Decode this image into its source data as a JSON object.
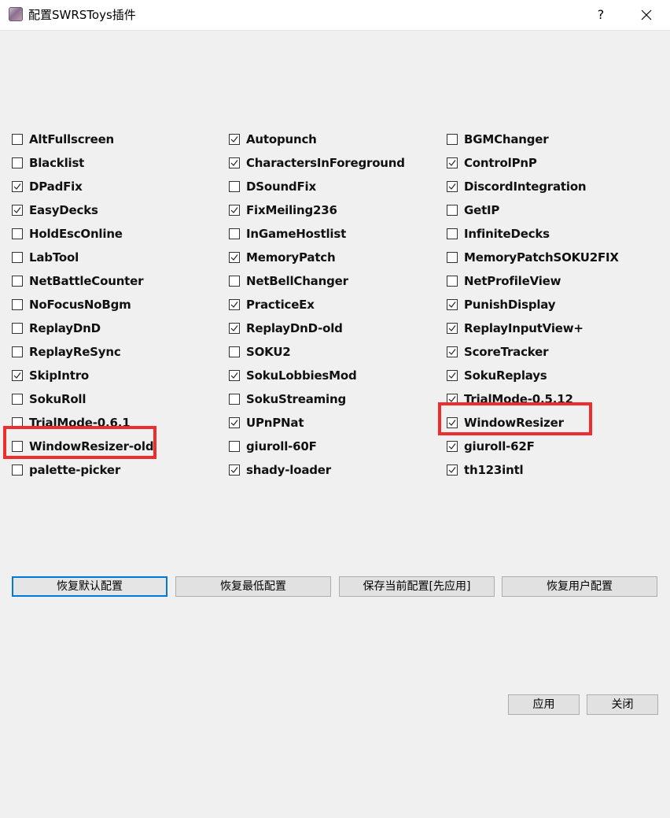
{
  "window": {
    "title": "配置SWRSToys插件",
    "help_label": "?"
  },
  "plugins": [
    {
      "label": "AltFullscreen",
      "checked": false
    },
    {
      "label": "Blacklist",
      "checked": false
    },
    {
      "label": "DPadFix",
      "checked": true
    },
    {
      "label": "EasyDecks",
      "checked": true
    },
    {
      "label": "HoldEscOnline",
      "checked": false
    },
    {
      "label": "LabTool",
      "checked": false
    },
    {
      "label": "NetBattleCounter",
      "checked": false
    },
    {
      "label": "NoFocusNoBgm",
      "checked": false
    },
    {
      "label": "ReplayDnD",
      "checked": false
    },
    {
      "label": "ReplayReSync",
      "checked": false
    },
    {
      "label": "SkipIntro",
      "checked": true
    },
    {
      "label": "SokuRoll",
      "checked": false
    },
    {
      "label": "TrialMode-0.6.1",
      "checked": false
    },
    {
      "label": "WindowResizer-old",
      "checked": false,
      "highlighted": true
    },
    {
      "label": "palette-picker",
      "checked": false
    },
    {
      "label": "Autopunch",
      "checked": true
    },
    {
      "label": "CharactersInForeground",
      "checked": true
    },
    {
      "label": "DSoundFix",
      "checked": false
    },
    {
      "label": "FixMeiling236",
      "checked": true
    },
    {
      "label": "InGameHostlist",
      "checked": false
    },
    {
      "label": "MemoryPatch",
      "checked": true
    },
    {
      "label": "NetBellChanger",
      "checked": false
    },
    {
      "label": "PracticeEx",
      "checked": true
    },
    {
      "label": "ReplayDnD-old",
      "checked": true
    },
    {
      "label": "SOKU2",
      "checked": false
    },
    {
      "label": "SokuLobbiesMod",
      "checked": true
    },
    {
      "label": "SokuStreaming",
      "checked": false
    },
    {
      "label": "UPnPNat",
      "checked": true
    },
    {
      "label": "giuroll-60F",
      "checked": false
    },
    {
      "label": "shady-loader",
      "checked": true
    },
    {
      "label": "BGMChanger",
      "checked": false
    },
    {
      "label": "ControlPnP",
      "checked": true
    },
    {
      "label": "DiscordIntegration",
      "checked": true
    },
    {
      "label": "GetIP",
      "checked": false
    },
    {
      "label": "InfiniteDecks",
      "checked": false
    },
    {
      "label": "MemoryPatchSOKU2FIX",
      "checked": false
    },
    {
      "label": "NetProfileView",
      "checked": false
    },
    {
      "label": "PunishDisplay",
      "checked": true
    },
    {
      "label": "ReplayInputView+",
      "checked": true
    },
    {
      "label": "ScoreTracker",
      "checked": true
    },
    {
      "label": "SokuReplays",
      "checked": true
    },
    {
      "label": "TrialMode-0.5.12",
      "checked": true
    },
    {
      "label": "WindowResizer",
      "checked": true,
      "highlighted": true
    },
    {
      "label": "giuroll-62F",
      "checked": true
    },
    {
      "label": "th123intl",
      "checked": true
    }
  ],
  "buttons": {
    "restore_default": "恢复默认配置",
    "restore_minimum": "恢复最低配置",
    "save_current": "保存当前配置[先应用]",
    "restore_user": "恢复用户配置",
    "apply": "应用",
    "close": "关闭"
  },
  "colors": {
    "window_bg": "#f0f0f0",
    "highlight": "#ee2e2e",
    "focus_border": "#0078d7",
    "button_bg": "#e1e1e1"
  }
}
